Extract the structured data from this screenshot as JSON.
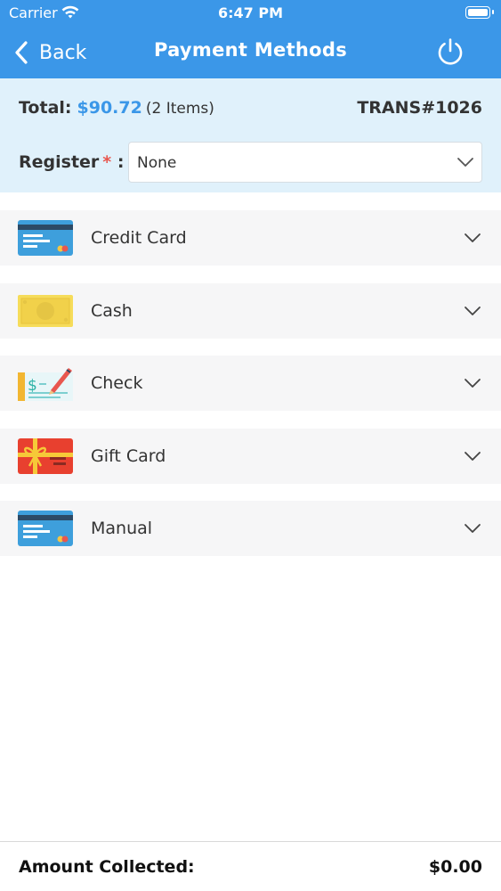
{
  "status_bar": {
    "carrier": "Carrier",
    "time": "6:47 PM",
    "wifi_icon": "wifi-icon",
    "battery_icon": "battery-icon"
  },
  "nav": {
    "back_label": "Back",
    "title": "Payment Methods",
    "back_icon": "chevron-left-icon",
    "power_icon": "power-icon",
    "color": "#3b97e8"
  },
  "summary": {
    "total_label": "Total:",
    "total_amount": "$90.72",
    "items": "(2 Items)",
    "transaction": "TRANS#1026",
    "register_label": "Register",
    "required_mark": "*",
    "colon": ":",
    "register_value": "None",
    "accent_color": "#3b97e8",
    "required_color": "#e8574f",
    "background": "#e0f1fb"
  },
  "methods": [
    {
      "label": "Credit Card",
      "icon": "credit-card-icon"
    },
    {
      "label": "Cash",
      "icon": "cash-icon"
    },
    {
      "label": "Check",
      "icon": "check-icon"
    },
    {
      "label": "Gift Card",
      "icon": "gift-card-icon"
    },
    {
      "label": "Manual",
      "icon": "manual-card-icon"
    }
  ],
  "footer": {
    "label": "Amount Collected:",
    "value": "$0.00"
  }
}
